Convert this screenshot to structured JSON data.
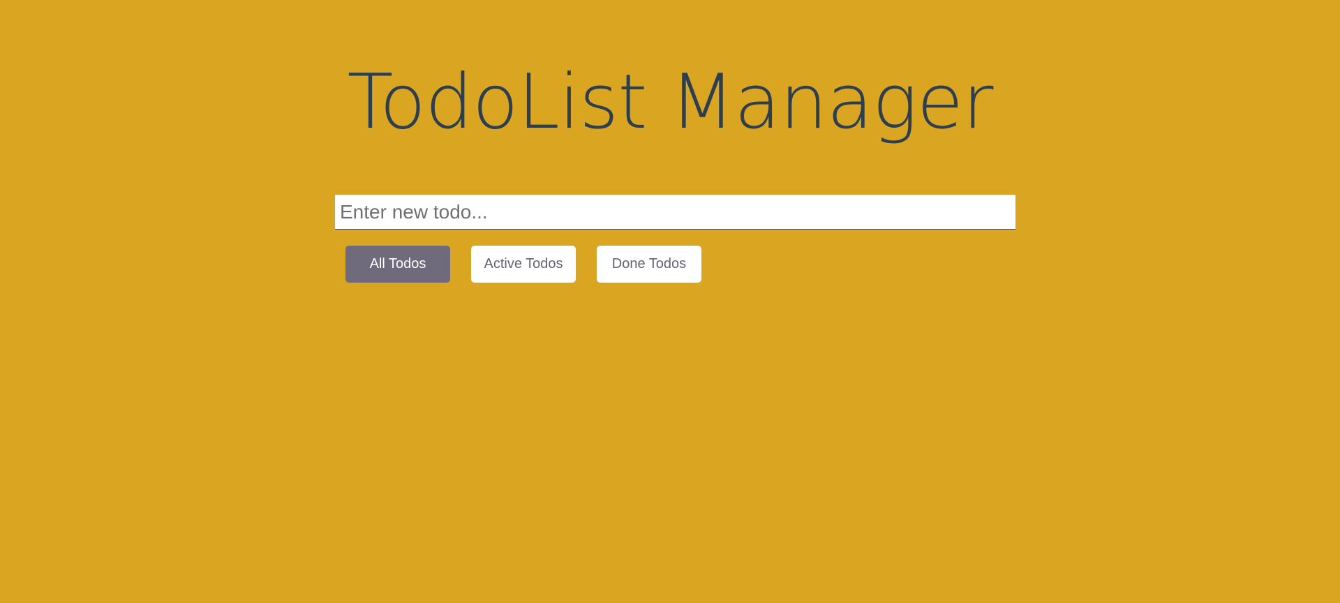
{
  "app": {
    "title": "TodoList Manager"
  },
  "input": {
    "placeholder": "Enter new todo...",
    "value": ""
  },
  "filters": [
    {
      "label": "All Todos",
      "active": true
    },
    {
      "label": "Active Todos",
      "active": false
    },
    {
      "label": "Done Todos",
      "active": false
    }
  ],
  "colors": {
    "background": "#DAA520",
    "title": "#2C3E50",
    "active_button": "#6F6A7C",
    "button": "#FFFFFF",
    "button_text": "#666270"
  }
}
